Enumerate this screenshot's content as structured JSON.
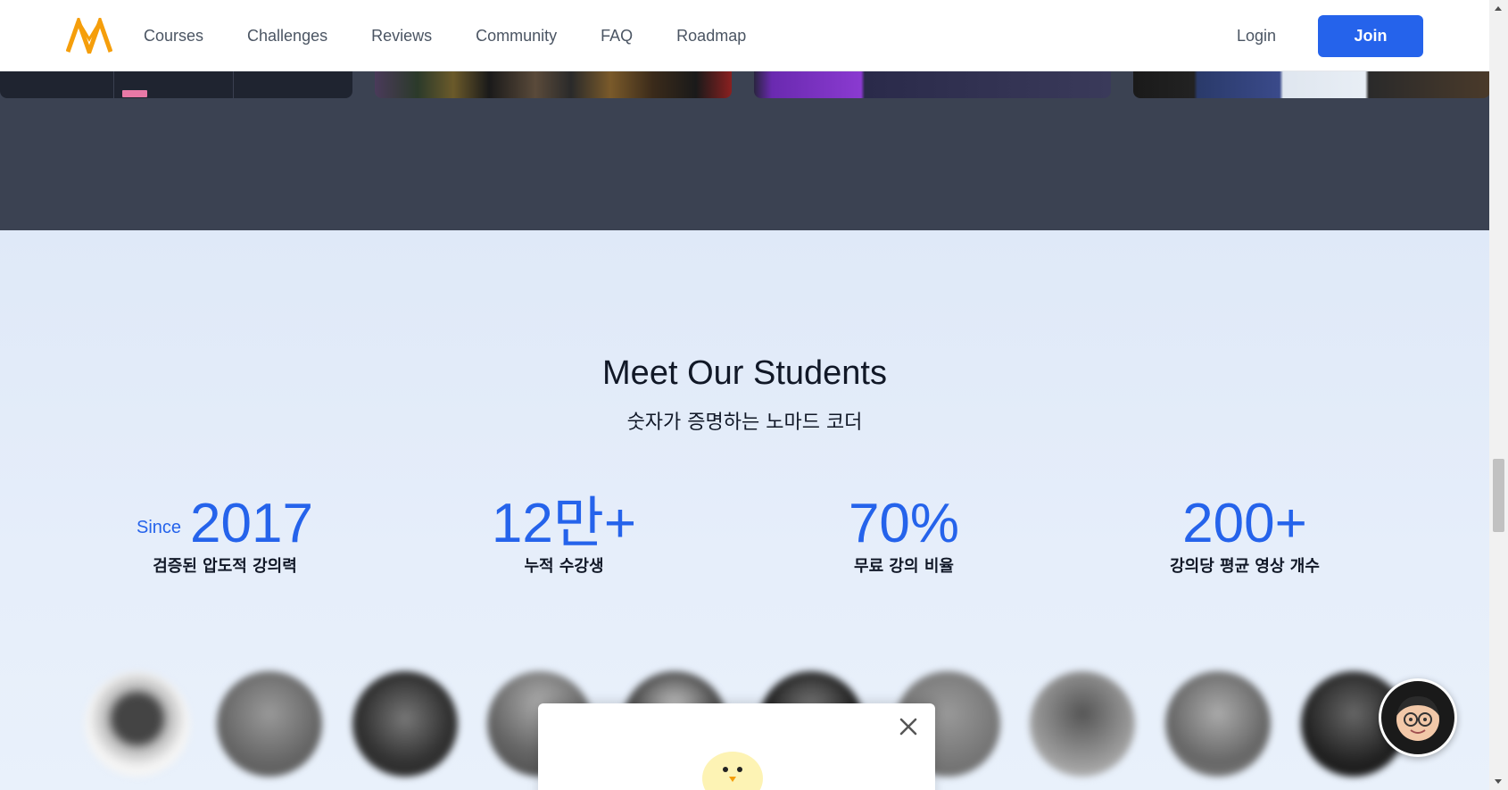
{
  "header": {
    "logo": "nomad-coders-logo-icon",
    "nav": [
      "Courses",
      "Challenges",
      "Reviews",
      "Community",
      "FAQ",
      "Roadmap"
    ],
    "login_label": "Login",
    "join_label": "Join"
  },
  "students": {
    "title": "Meet Our Students",
    "subtitle": "숫자가 증명하는 노마드 코더",
    "stats": [
      {
        "prefix": "Since",
        "value": "2017",
        "label": "검증된 압도적 강의력"
      },
      {
        "prefix": "",
        "value": "12만+",
        "label": "누적 수강생"
      },
      {
        "prefix": "",
        "value": "70%",
        "label": "무료 강의 비율"
      },
      {
        "prefix": "",
        "value": "200+",
        "label": "강의당 평균 영상 개수"
      }
    ]
  },
  "colors": {
    "accent": "#2563eb",
    "logo": "#f59e0b",
    "dark_band": "#3b4252",
    "section_bg": "#e2ebf8"
  },
  "popup": {
    "close_icon": "close-icon",
    "image": "chick-icon"
  },
  "chat": {
    "icon": "chat-avatar-icon"
  }
}
